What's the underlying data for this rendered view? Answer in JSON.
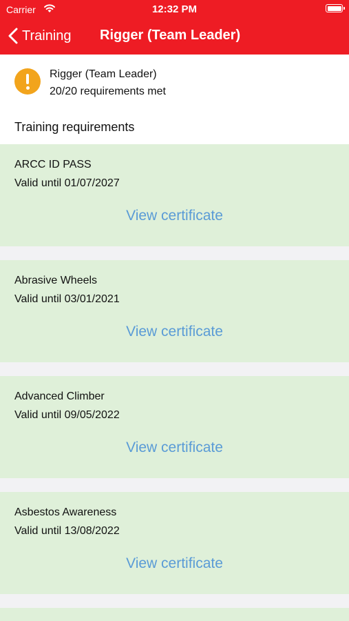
{
  "status_bar": {
    "carrier": "Carrier",
    "time": "12:32 PM"
  },
  "nav": {
    "back_label": "Training",
    "title": "Rigger (Team Leader)"
  },
  "summary": {
    "title": "Rigger (Team Leader)",
    "subtitle": "20/20 requirements met",
    "icon": "warning-icon",
    "icon_color": "#f2a41c"
  },
  "section_title": "Training requirements",
  "colors": {
    "header": "#ee1c24",
    "card_bg": "#dff0d9",
    "link": "#5a9bd6"
  },
  "requirements": [
    {
      "name": "ARCC ID PASS",
      "valid": "Valid until 01/07/2027",
      "action": "View certificate"
    },
    {
      "name": "Abrasive Wheels",
      "valid": "Valid until 03/01/2021",
      "action": "View certificate"
    },
    {
      "name": "Advanced Climber",
      "valid": "Valid until 09/05/2022",
      "action": "View certificate"
    },
    {
      "name": "Asbestos Awareness",
      "valid": "Valid until 13/08/2022",
      "action": "View certificate"
    }
  ]
}
